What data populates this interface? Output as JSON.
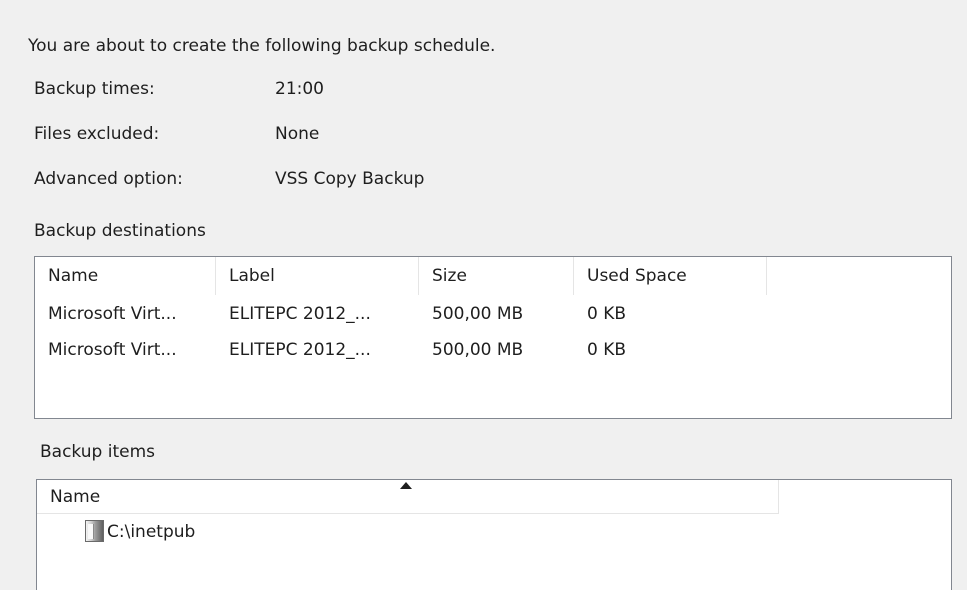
{
  "intro_text": "You are about to create the following backup schedule.",
  "summary": [
    {
      "label": "Backup times:",
      "value": "21:00"
    },
    {
      "label": "Files excluded:",
      "value": "None"
    },
    {
      "label": "Advanced option:",
      "value": "VSS Copy Backup"
    }
  ],
  "destinations": {
    "title": "Backup destinations",
    "columns": [
      "Name",
      "Label",
      "Size",
      "Used Space"
    ],
    "rows": [
      {
        "name": "Microsoft Virt...",
        "label": "ELITEPC 2012_...",
        "size": "500,00 MB",
        "used": "0 KB"
      },
      {
        "name": "Microsoft Virt...",
        "label": "ELITEPC 2012_...",
        "size": "500,00 MB",
        "used": "0 KB"
      }
    ]
  },
  "items": {
    "title": "Backup items",
    "columns": [
      "Name"
    ],
    "sort_indicator": "ascending",
    "rows": [
      {
        "name": "C:\\inetpub",
        "icon": "folder-icon"
      }
    ]
  }
}
